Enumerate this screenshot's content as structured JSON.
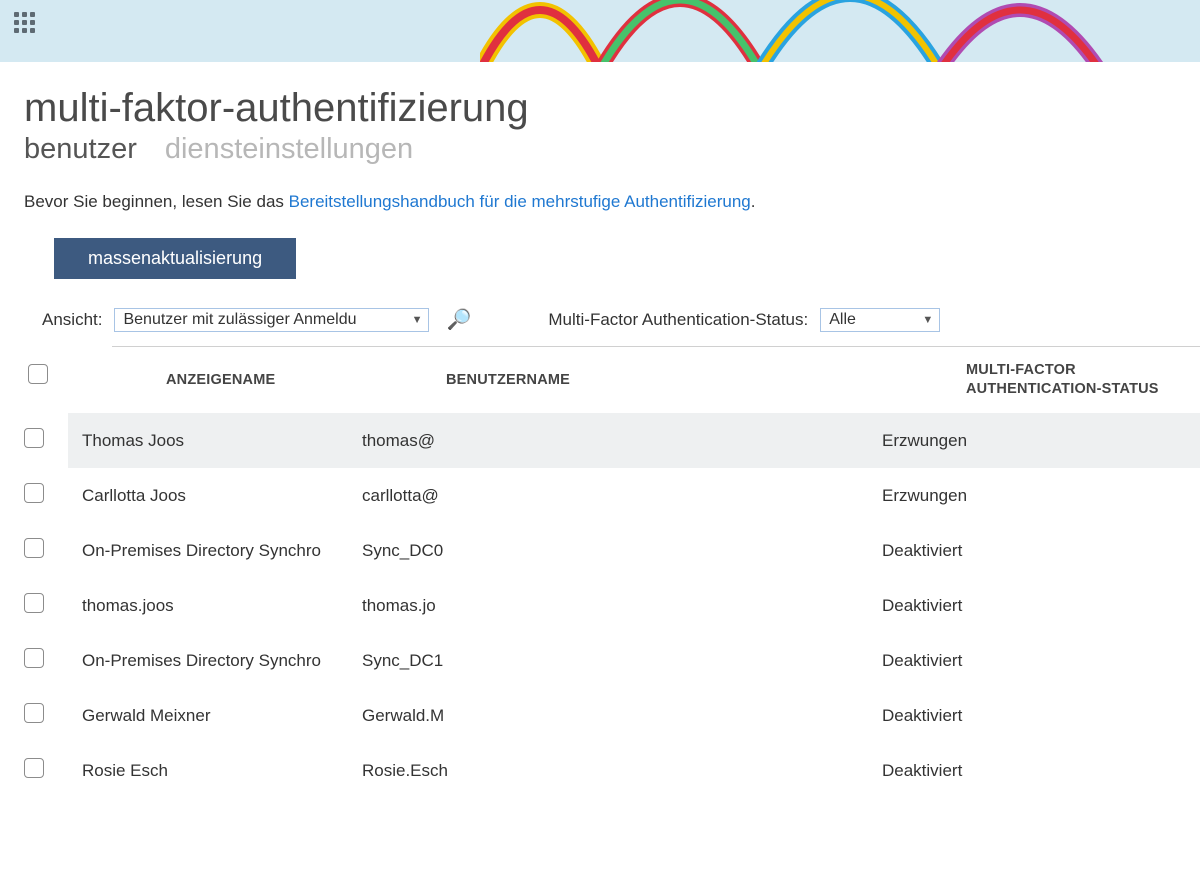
{
  "header": {
    "page_title": "multi-faktor-authentifizierung"
  },
  "tabs": {
    "users": "benutzer",
    "settings": "diensteinstellungen"
  },
  "intro": {
    "prefix": "Bevor Sie beginnen, lesen Sie das ",
    "link_text": "Bereitstellungshandbuch für die mehrstufige Authentifizierung",
    "suffix": "."
  },
  "buttons": {
    "bulk_update": "massenaktualisierung"
  },
  "filters": {
    "view_label": "Ansicht:",
    "view_value": "Benutzer mit zulässiger Anmeldu",
    "status_label": "Multi-Factor Authentication-Status:",
    "status_value": "Alle"
  },
  "table": {
    "columns": {
      "display_name": "ANZEIGENAME",
      "username": "BENUTZERNAME",
      "mfa_status_line1": "MULTI-FACTOR",
      "mfa_status_line2": "AUTHENTICATION-STATUS"
    },
    "rows": [
      {
        "display_name": "Thomas Joos",
        "username": "thomas@",
        "status": "Erzwungen",
        "selected": true
      },
      {
        "display_name": "Carllotta Joos",
        "username": "carllotta@",
        "status": "Erzwungen",
        "selected": false
      },
      {
        "display_name": "On-Premises Directory Synchro",
        "username": "Sync_DC0",
        "status": "Deaktiviert",
        "selected": false
      },
      {
        "display_name": "thomas.joos",
        "username": "thomas.jo",
        "status": "Deaktiviert",
        "selected": false
      },
      {
        "display_name": "On-Premises Directory Synchro",
        "username": "Sync_DC1",
        "status": "Deaktiviert",
        "selected": false
      },
      {
        "display_name": "Gerwald Meixner",
        "username": "Gerwald.M",
        "status": "Deaktiviert",
        "selected": false
      },
      {
        "display_name": "Rosie Esch",
        "username": "Rosie.Esch",
        "status": "Deaktiviert",
        "selected": false
      }
    ]
  }
}
